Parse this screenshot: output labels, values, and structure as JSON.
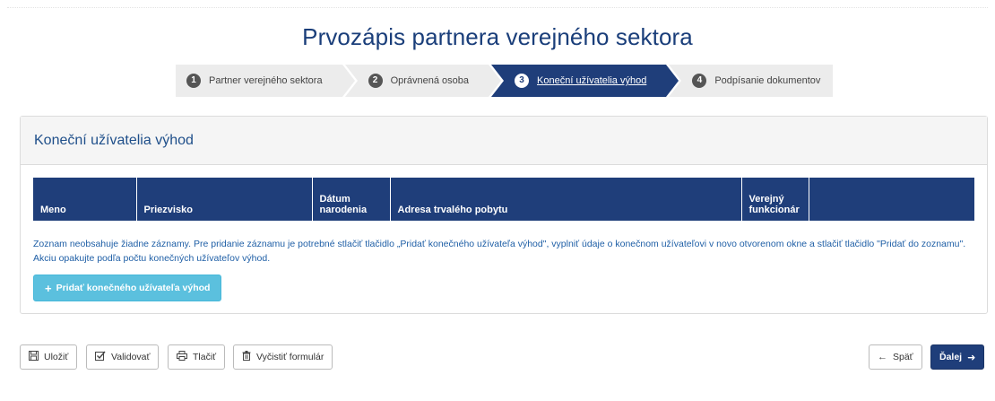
{
  "page": {
    "title": "Prvozápis partnera verejného sektora"
  },
  "steps": [
    {
      "number": "1",
      "label": "Partner verejného sektora",
      "active": false
    },
    {
      "number": "2",
      "label": "Oprávnená osoba",
      "active": false
    },
    {
      "number": "3",
      "label": "Koneční užívatelia výhod",
      "active": true
    },
    {
      "number": "4",
      "label": "Podpísanie dokumentov",
      "active": false
    }
  ],
  "panel": {
    "title": "Koneční užívatelia výhod",
    "table": {
      "columns": [
        "Meno",
        "Priezvisko",
        "Dátum narodenia",
        "Adresa trvalého pobytu",
        "Verejný funkcionár",
        ""
      ]
    },
    "empty_note": "Zoznam neobsahuje žiadne záznamy. Pre pridanie záznamu je potrebné stlačiť tlačidlo „Pridať konečného užívateľa výhod\", vyplniť údaje o konečnom užívateľovi v novo otvorenom okne a stlačiť tlačidlo \"Pridať do zoznamu\". Akciu opakujte podľa počtu konečných užívateľov výhod.",
    "add_button": "Pridať konečného užívateľa výhod"
  },
  "actions": {
    "save": "Uložiť",
    "validate": "Validovať",
    "print": "Tlačiť",
    "clear": "Vyčistiť formulár",
    "back": "Späť",
    "next": "Ďalej"
  },
  "colors": {
    "primary": "#1f3e7a",
    "info": "#5bc0de",
    "link": "#1f5fa6"
  }
}
